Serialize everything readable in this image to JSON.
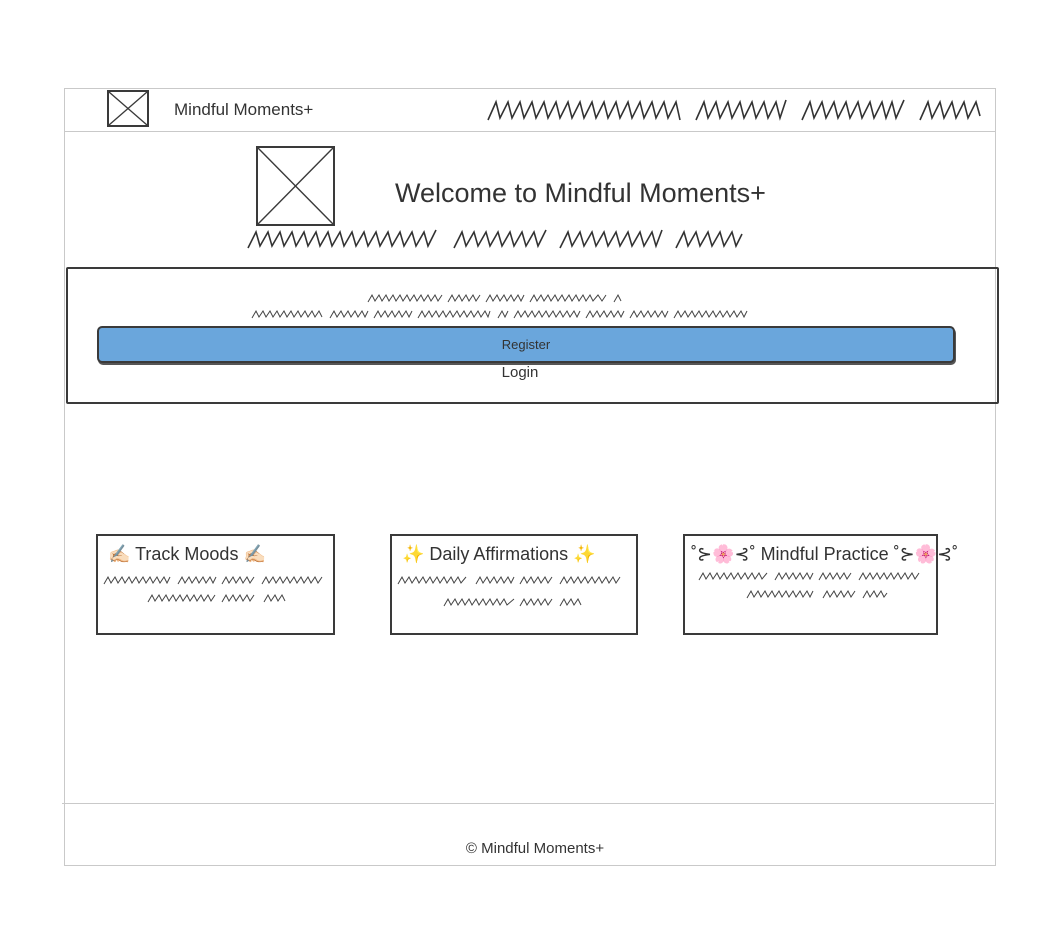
{
  "header": {
    "logo_text": "Mindful Moments+"
  },
  "hero": {
    "title": "Welcome to Mindful Moments+"
  },
  "auth": {
    "register_label": "Register",
    "login_label": "Login",
    "register_color": "#6aa6dc"
  },
  "features": [
    {
      "title": "✍🏻 Track Moods ✍🏻"
    },
    {
      "title": "✨ Daily Affirmations ✨"
    },
    {
      "title": "˚⊱🌸⊰˚ Mindful Practice ˚⊱🌸⊰˚"
    }
  ],
  "footer": {
    "copyright": "© Mindful Moments+"
  }
}
